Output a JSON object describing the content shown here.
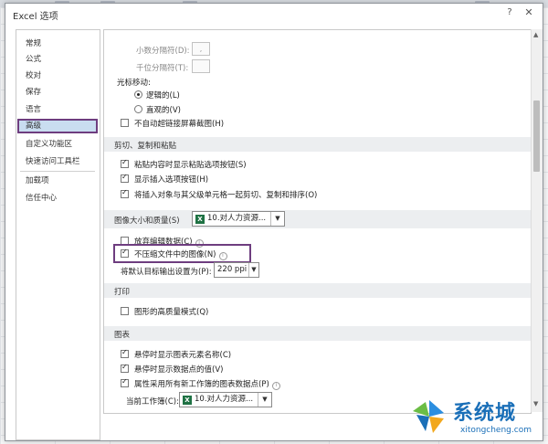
{
  "dialog": {
    "title": "Excel 选项",
    "help": "?",
    "close": "✕"
  },
  "nav": {
    "items": [
      {
        "label": "常规"
      },
      {
        "label": "公式"
      },
      {
        "label": "校对"
      },
      {
        "label": "保存"
      },
      {
        "label": "语言"
      },
      {
        "label": "高级",
        "selected": true
      },
      {
        "label": "自定义功能区"
      },
      {
        "label": "快速访问工具栏"
      },
      {
        "label": "加载项"
      },
      {
        "label": "信任中心"
      }
    ]
  },
  "advanced": {
    "decimal_separator": "小数分隔符(D):",
    "thousands_separator": "千位分隔符(T):",
    "cursor_movement": "光标移动:",
    "logical": "逻辑的(L)",
    "visual": "直观的(V)",
    "no_autohyperlink": "不自动超链接屏幕截图(H)",
    "cut_copy_paste": {
      "heading": "剪切、复制和粘贴",
      "show_paste_options": "粘贴内容时显示粘贴选项按钮(S)",
      "show_insert_options": "显示插入选项按钮(H)",
      "move_objects": "将插入对象与其父级单元格一起剪切、复制和排序(O)"
    },
    "image_size_quality": {
      "heading": "图像大小和质量(S)",
      "workbook": "10.对人力资源...",
      "discard_edit_data": "放弃编辑数据(C)",
      "no_compress": "不压缩文件中的图像(N)",
      "default_output_label": "将默认目标输出设置为(P):",
      "default_output_value": "220 ppi"
    },
    "print": {
      "heading": "打印",
      "high_quality_graphics": "图形的高质量模式(Q)"
    },
    "chart": {
      "heading": "图表",
      "show_element_names": "悬停时显示图表元素名称(C)",
      "show_data_point_values": "悬停时显示数据点的值(V)",
      "properties_follow": "属性采用所有新工作簿的图表数据点(P)",
      "current_workbook_label": "当前工作簿(C):",
      "current_workbook_value": "10.对人力资源..."
    }
  },
  "watermark": {
    "name": "系统城",
    "url": "xitongcheng.com"
  }
}
